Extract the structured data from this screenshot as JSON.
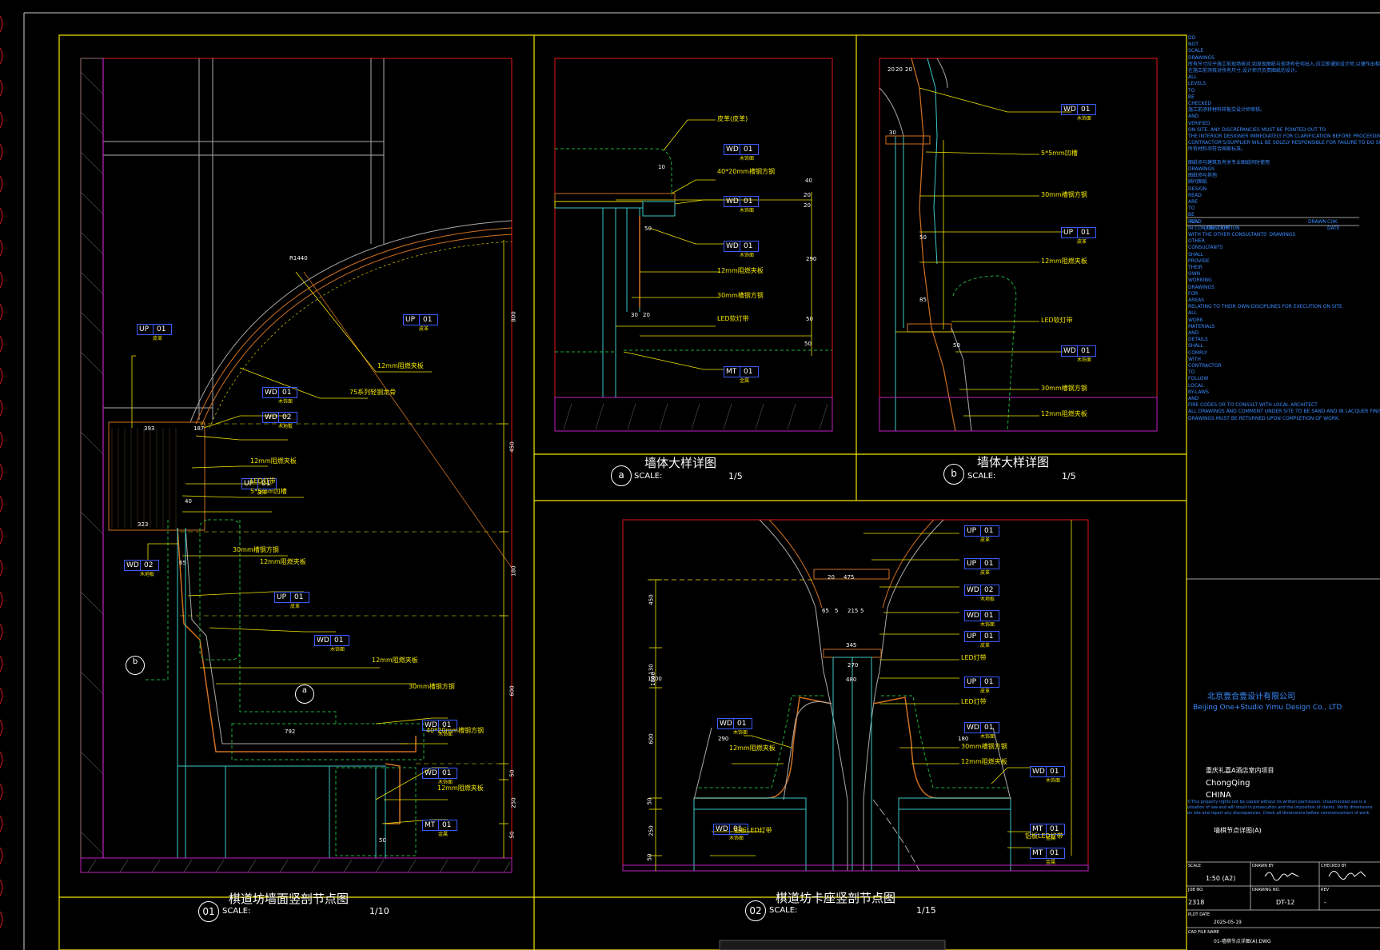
{
  "colors": {
    "background": "#000000",
    "frame": "#f2e600",
    "detail_red": "#e0181e",
    "callout": "#f2e600",
    "tag_border": "#3b5bff",
    "notes_blue": "#3b8cff",
    "wall_orange": "#d07020",
    "bench_green": "#1fae3a",
    "tile_magenta": "#c020c0",
    "steel_cyan": "#3cc8c8"
  },
  "sheets": {
    "s01": {
      "badge": "01",
      "title": "棋道坊墙面竖剖节点图",
      "scale_label": "SCALE:",
      "scale_value": "1/10"
    },
    "s02": {
      "badge": "02",
      "title": "棋道坊卡座竖剖节点图",
      "scale_label": "SCALE:",
      "scale_value": "1/15"
    },
    "sa": {
      "badge": "a",
      "title": "墙体大样详图",
      "scale_label": "SCALE:",
      "scale_value": "1/5"
    },
    "sb": {
      "badge": "b",
      "title": "墙体大样详图",
      "scale_label": "SCALE:",
      "scale_value": "1/5"
    }
  },
  "tags": [
    {
      "code": "UP",
      "num": "01",
      "sub": "皮革"
    },
    {
      "code": "UP",
      "num": "01",
      "sub": "皮革"
    },
    {
      "code": "WD",
      "num": "01",
      "sub": "木饰面"
    },
    {
      "code": "WD",
      "num": "02",
      "sub": "木地板"
    },
    {
      "code": "UP",
      "num": "01",
      "sub": "皮革"
    },
    {
      "code": "WD",
      "num": "02",
      "sub": "木地板"
    },
    {
      "code": "UP",
      "num": "01",
      "sub": "皮革"
    },
    {
      "code": "WD",
      "num": "01",
      "sub": "木饰面"
    },
    {
      "code": "WD",
      "num": "01",
      "sub": "木饰面"
    },
    {
      "code": "WD",
      "num": "01",
      "sub": "木饰面"
    },
    {
      "code": "MT",
      "num": "01",
      "sub": "金属"
    },
    {
      "code": "WD",
      "num": "01",
      "sub": "木饰面"
    },
    {
      "code": "WD",
      "num": "01",
      "sub": "木饰面"
    },
    {
      "code": "WD",
      "num": "01",
      "sub": "木饰面"
    },
    {
      "code": "MT",
      "num": "01",
      "sub": "金属"
    },
    {
      "code": "WD",
      "num": "01",
      "sub": "木饰面"
    },
    {
      "code": "UP",
      "num": "01",
      "sub": "皮革"
    },
    {
      "code": "WD",
      "num": "01",
      "sub": "木饰面"
    },
    {
      "code": "UP",
      "num": "01",
      "sub": "皮革"
    },
    {
      "code": "UP",
      "num": "01",
      "sub": "皮革"
    },
    {
      "code": "WD",
      "num": "02",
      "sub": "木地板"
    },
    {
      "code": "WD",
      "num": "01",
      "sub": "木饰面"
    },
    {
      "code": "UP",
      "num": "01",
      "sub": "皮革"
    },
    {
      "code": "UP",
      "num": "01",
      "sub": "皮革"
    },
    {
      "code": "WD",
      "num": "01",
      "sub": "木饰面"
    },
    {
      "code": "WD",
      "num": "01",
      "sub": "木饰面"
    },
    {
      "code": "WD",
      "num": "01",
      "sub": "木饰面"
    },
    {
      "code": "MT",
      "num": "01",
      "sub": "金属"
    },
    {
      "code": "WD",
      "num": "01",
      "sub": "木饰面"
    },
    {
      "code": "MT",
      "num": "01",
      "sub": "金属"
    }
  ],
  "callouts": {
    "c1": "12mm阻燃夹板",
    "c2": "75系列轻钢龙骨",
    "c3": "12mm阻燃夹板",
    "c4": "LED灯带",
    "c5": "5*5mm凹槽",
    "c6": "30mm槽钢方钢",
    "c7": "12mm阻燃夹板",
    "c8": "12mm阻燃夹板",
    "c9": "30mm槽钢方钢",
    "c10": "40*20mm槽钢方钢",
    "c11": "12mm阻燃夹板",
    "a1": "皮革(皮革)",
    "a2": "40*20mm槽钢方钢",
    "a3": "12mm阻燃夹板",
    "a4": "30mm槽钢方钢",
    "a5": "LED软灯带",
    "b1": "5*5mm凹槽",
    "b2": "30mm槽钢方钢",
    "b3": "12mm阻燃夹板",
    "b4": "LED软灯带",
    "b5": "30mm槽钢方钢",
    "b6": "12mm阻燃夹板",
    "d1": "LED灯带",
    "d2": "LED灯带",
    "d3": "12mm阻燃夹板",
    "d4": "30mm槽钢方钢",
    "d5": "12mm阻燃夹板",
    "d6": "铝板LED灯带",
    "d7": "铝板LED灯带"
  },
  "dims": {
    "left": [
      "800",
      "450",
      "180",
      "600",
      "50",
      "250",
      "50"
    ],
    "s01": [
      "393",
      "187",
      "323",
      "40",
      "65",
      "792",
      "50",
      "R1440"
    ],
    "sa": [
      "10",
      "40",
      "20",
      "20",
      "50",
      "50",
      "20",
      "30",
      "290",
      "50"
    ],
    "sb": [
      "20",
      "20",
      "20",
      "50",
      "85",
      "50",
      "30",
      "1800"
    ],
    "s02_left": [
      "450",
      "130",
      "1800",
      "600",
      "50",
      "250",
      "50"
    ],
    "s02": [
      "475",
      "65",
      "5",
      "215",
      "5",
      "345",
      "270",
      "480",
      "290",
      "180",
      "20"
    ]
  },
  "notes": [
    "DO",
    "NOT",
    "SCALE",
    "DRAWINGS",
    "所有尺寸应于施工前现场核对,如发现图纸与现场有任何出入,应立即通知设计师,以便作出相应的修正。",
    "在施工前须核对所有尺寸,设计师只负责图纸的设计。",
    "ALL",
    "LEVELS",
    "TO",
    "BE",
    "CHECKED",
    "施工前须将材料样板交设计师审核。",
    "AND",
    "VERIFIED",
    "ON SITE. ANY DISCREPANCIES MUST BE POINTED OUT TO",
    "THE INTERIOR DESIGNER IMMEDIATELY FOR CLARIFICATION BEFORE PROCEEDING. THE",
    "CONTRACTOR'S/SUPPLIER WILL BE SOLELY RESPONSIBLE FOR FAILURE TO DO SO.",
    "所有材料须符合国家标准。",
    "",
    "图纸须与建筑及有关专业图纸同时使用",
    "DRAWINGS",
    "图纸须与其他",
    "顾问图纸",
    "DESIGN",
    "READ",
    "ARE",
    "TO",
    "BE",
    "READ",
    "IN CONJUNCTION",
    "WITH THE OTHER CONSULTANTS' DRAWINGS",
    "OTHER",
    "CONSULTANTS",
    "SHALL",
    "PROVIDE",
    "THEIR",
    "OWN",
    "WORKING",
    "DRAWINGS",
    "FOR",
    "AREAS",
    "RELATING TO THEIR OWN DISCIPLINES FOR EXECUTION ON SITE",
    "ALL",
    "WORK",
    "MATERIALS",
    "AND",
    "DETAILS",
    "SHALL",
    "COMPLY",
    "WITH",
    "CONTRACTOR",
    "TO",
    "FOLLOW",
    "LOCAL",
    "BY-LAWS",
    "AND",
    "FIRE CODES OR TO CONSULT WITH LOCAL ARCHITECT",
    "ALL DRAWINGS AND COMMENT UNDER SITE TO BE SAND AND IN LACQUER FINISH.",
    "DRAWINGS MUST BE RETURNED UPON COMPLETION OF WORK."
  ],
  "revision": {
    "col1": "REV",
    "col2": "DESCRIPTION",
    "col3": "DRAWN",
    "col4": "CHK",
    "col5": "DATE"
  },
  "logo": {
    "cn": "北京壹合壹设计有限公司",
    "en": "Beijing One+Studio Yimu Design Co., LTD"
  },
  "project": {
    "cn": "重庆礼嘉A酒店室内项目",
    "city": "ChongQing",
    "country": "CHINA",
    "drawing_cn": "墙棋节点详图(A)",
    "copyright": "©This property rights not be copied without its written permission. Unauthorized use is a violation of law and will result in prosecution and the imposition of claims. Verify dimensions on site and report any discrepancies. Check all dimensions before commencement of work."
  },
  "titleblock": {
    "scale_label": "SCALE",
    "scale": "1:50 (A2)",
    "drawn_label": "DRAWN BY",
    "checked_label": "CHECKED BY",
    "job_label": "JOB NO.",
    "job_no": "2318",
    "drawing_label": "DRAWING NO.",
    "drawing_no": "DT-12",
    "rev_label": "REV",
    "rev": "-",
    "plot_label": "PLOT DATE",
    "plot_date": "2025-05-19",
    "cad_label": "CAD FILE NAME",
    "cad_file": "01-墙棋节点详图(A).DWG"
  }
}
